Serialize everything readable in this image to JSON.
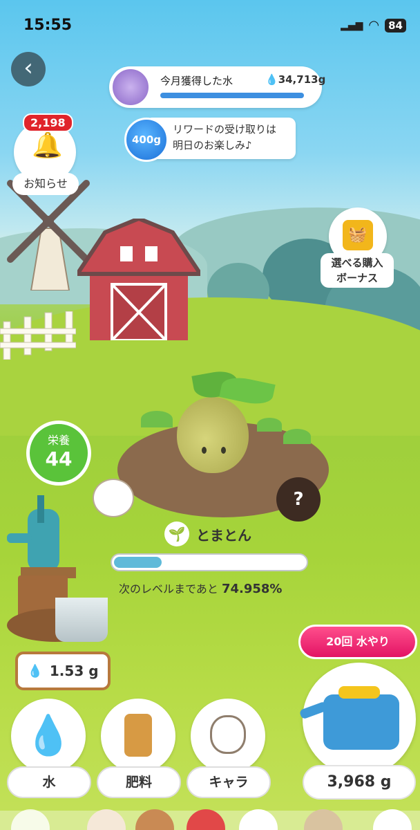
{
  "status_bar": {
    "time": "15:55",
    "battery": "84"
  },
  "header": {
    "monthly_water": {
      "label": "今月獲得した水",
      "amount": "34,713g",
      "progress_fraction": 1.0
    },
    "reward": {
      "jar_label": "400g",
      "line1": "リワードの受け取りは",
      "line2": "明日のお楽しみ♪"
    }
  },
  "notification": {
    "badge_count": "2,198",
    "label": "お知らせ"
  },
  "bonus": {
    "line1": "選べる購入",
    "line2": "ボーナス"
  },
  "nutrition": {
    "label": "栄養",
    "value": "44"
  },
  "plant": {
    "name": "とまとん",
    "level_progress_text": "次のレベルまであと",
    "level_progress_value": "74.958%",
    "level_progress_fraction": 0.25
  },
  "water_stock": {
    "amount": "1.53 g"
  },
  "watering": {
    "multi_button_label": "20回 水やり",
    "can_amount": "3,968 g"
  },
  "bottom_menu": [
    {
      "label": "水",
      "icon": "water-drop-icon"
    },
    {
      "label": "肥料",
      "icon": "fertilizer-bag-icon"
    },
    {
      "label": "キャラ",
      "icon": "hamster-character-icon"
    }
  ],
  "colors": {
    "accent_pink": "#e21364",
    "nutrition_green": "#5ac33a",
    "progress_blue": "#3d8fe0",
    "badge_red": "#e0242b"
  }
}
